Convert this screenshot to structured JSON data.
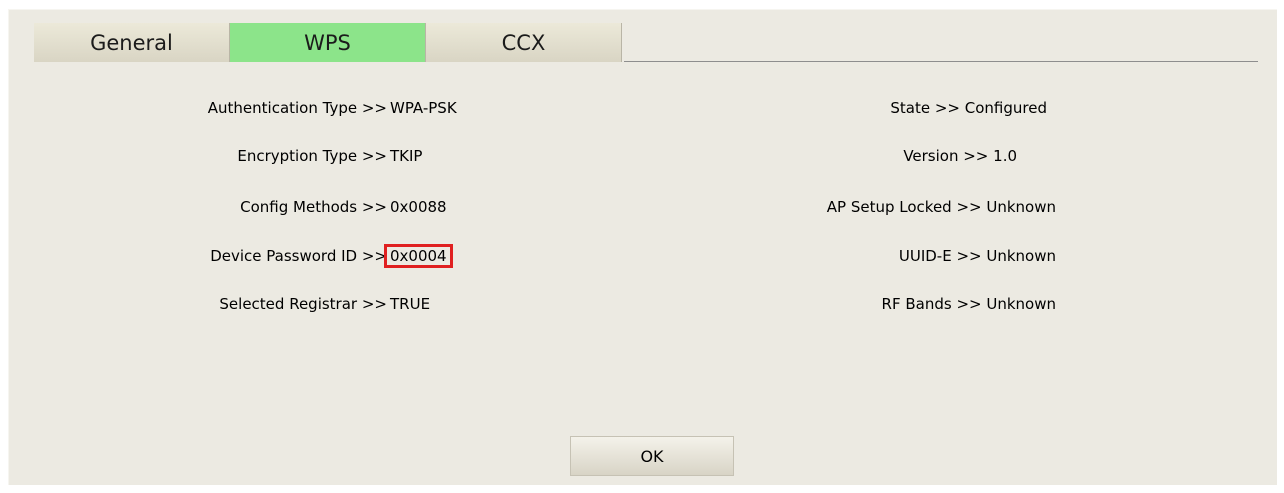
{
  "tabs": [
    {
      "label": "General"
    },
    {
      "label": "WPS"
    },
    {
      "label": "CCX"
    }
  ],
  "left_fields": [
    {
      "label": "Authentication Type >>",
      "value": "WPA-PSK"
    },
    {
      "label": "Encryption Type >>",
      "value": "TKIP"
    },
    {
      "label": "Config Methods >>",
      "value": "0x0088"
    },
    {
      "label": "Device Password ID >>",
      "value": "0x0004"
    },
    {
      "label": "Selected Registrar >>",
      "value": "TRUE"
    }
  ],
  "right_fields": [
    {
      "text": "State >> Configured"
    },
    {
      "text": "Version >> 1.0"
    },
    {
      "text": "AP Setup Locked >> Unknown"
    },
    {
      "text": "UUID-E >> Unknown"
    },
    {
      "text": "RF Bands >> Unknown"
    }
  ],
  "ok_label": "OK",
  "colors": {
    "active_tab": "#8ce48a",
    "highlight": "#e02020",
    "dialog_bg": "#eceae2"
  }
}
